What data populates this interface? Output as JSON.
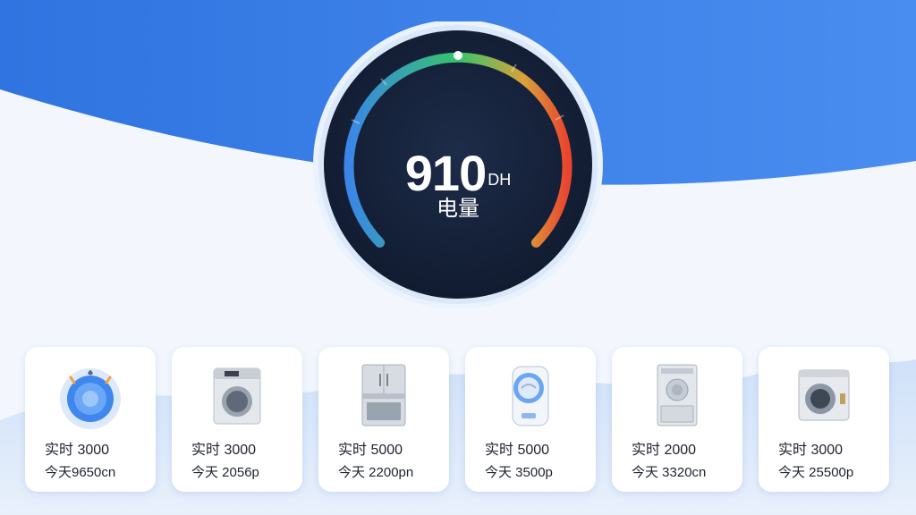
{
  "gauge": {
    "value": "910",
    "unit": "DH",
    "label": "电量",
    "level": 0.5
  },
  "devices": [
    {
      "icon": "water-heater-icon",
      "live": "实时 3000",
      "today": "今天9650cn"
    },
    {
      "icon": "washing-machine-icon",
      "live": "实时 3000",
      "today": "今天 2056p"
    },
    {
      "icon": "refrigerator-icon",
      "live": "实时 5000",
      "today": "今天 2200pn"
    },
    {
      "icon": "air-purifier-icon",
      "live": "实时 5000",
      "today": "今天 3500p"
    },
    {
      "icon": "dishwasher-icon",
      "live": "实时 2000",
      "today": "今天 3320cn"
    },
    {
      "icon": "dryer-icon",
      "live": "实时 3000",
      "today": "今天 25500p"
    }
  ],
  "colors": {
    "header_blue": "#3a7ee6",
    "gauge_face": "#14213a",
    "gauge_low": "#3a86e8",
    "gauge_mid": "#36c46a",
    "gauge_high": "#e8452f"
  }
}
